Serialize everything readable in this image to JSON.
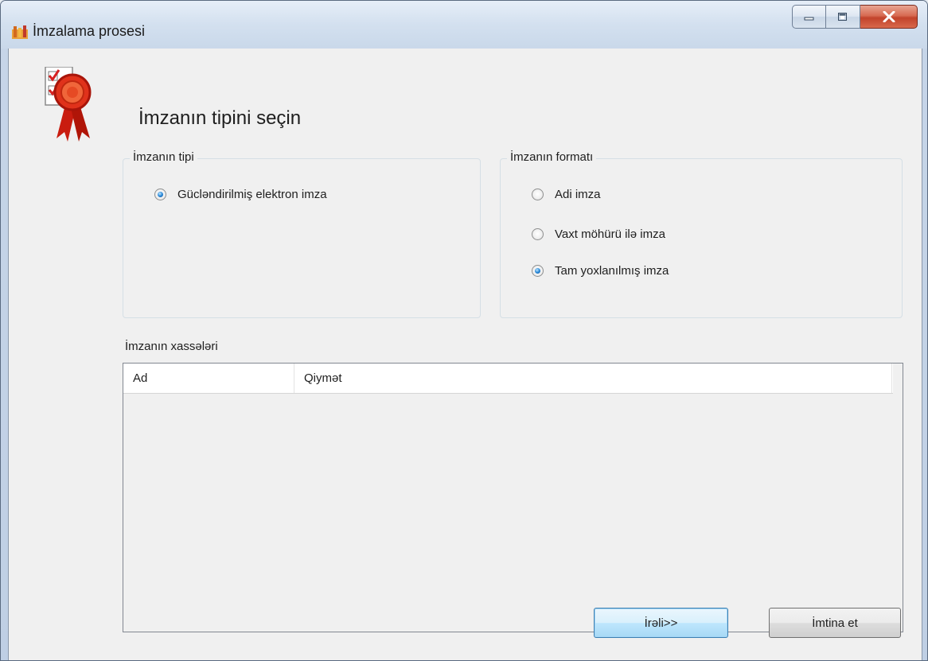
{
  "window": {
    "title": "İmzalama prosesi",
    "accent_color": "#c2432b"
  },
  "header": {
    "title": "İmzanın tipini seçin",
    "icon": "signature-certificate-icon"
  },
  "signature_type": {
    "legend": "İmzanın tipi",
    "options": [
      {
        "label": "Gücləndirilmiş elektron imza",
        "checked": true
      }
    ]
  },
  "signature_format": {
    "legend": "İmzanın formatı",
    "options": [
      {
        "label": "Adi imza",
        "checked": false
      },
      {
        "label": "Vaxt möhürü ilə imza",
        "checked": false
      },
      {
        "label": "Tam yoxlanılmış imza",
        "checked": true
      }
    ]
  },
  "properties": {
    "label": "İmzanın xassələri",
    "columns": [
      "Ad",
      "Qiymət"
    ],
    "rows": []
  },
  "buttons": {
    "next": "İrəli>>",
    "cancel": "İmtina et"
  }
}
